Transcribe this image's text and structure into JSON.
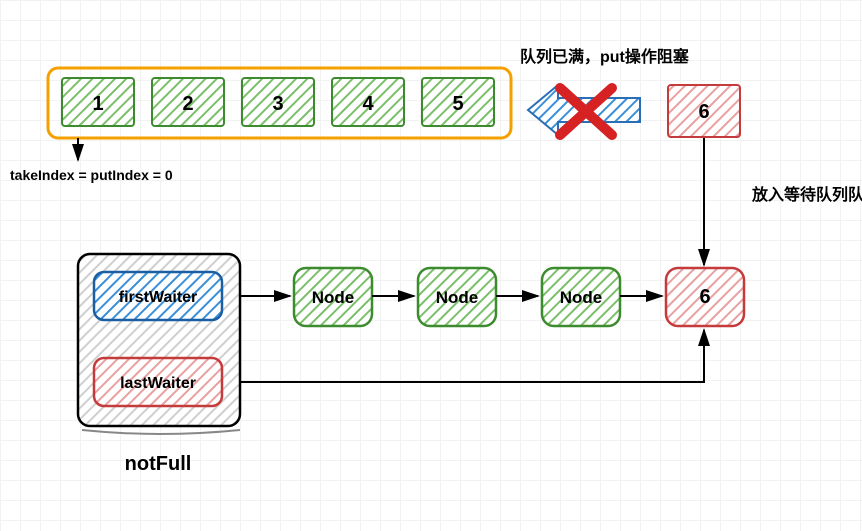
{
  "queue": {
    "cells": [
      "1",
      "2",
      "3",
      "4",
      "5"
    ]
  },
  "blocked_item": "6",
  "blocked_caption": "队列已满，put操作阻塞",
  "wait_tail_caption": "放入等待队列队尾",
  "index_caption": "takeIndex = putIndex = 0",
  "notFull": {
    "title": "notFull",
    "first": "firstWaiter",
    "last": "lastWaiter"
  },
  "nodes": [
    "Node",
    "Node",
    "Node"
  ],
  "tail_node": "6"
}
